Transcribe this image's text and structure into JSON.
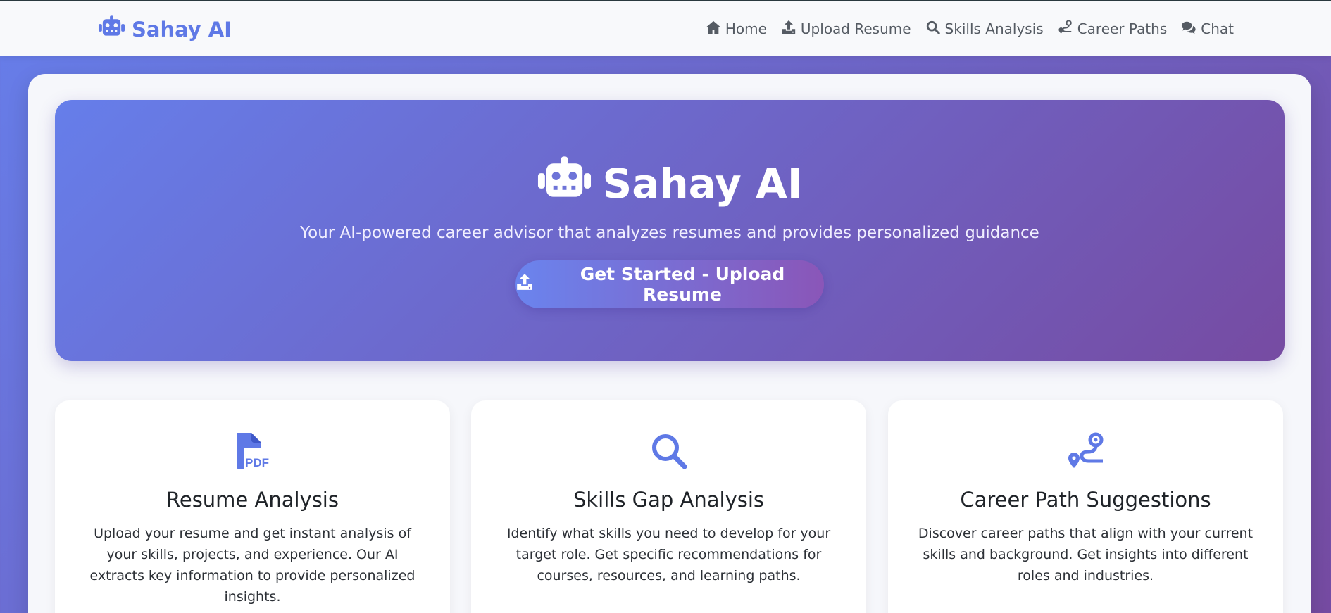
{
  "brand": {
    "name": "Sahay AI"
  },
  "nav": {
    "items": [
      {
        "label": "Home",
        "icon": "home-icon"
      },
      {
        "label": "Upload Resume",
        "icon": "upload-icon"
      },
      {
        "label": "Skills Analysis",
        "icon": "search-icon"
      },
      {
        "label": "Career Paths",
        "icon": "route-icon"
      },
      {
        "label": "Chat",
        "icon": "chat-icon"
      }
    ]
  },
  "hero": {
    "title": "Sahay AI",
    "subtitle": "Your AI-powered career advisor that analyzes resumes and provides personalized guidance",
    "cta_label": "Get Started - Upload Resume"
  },
  "features": [
    {
      "icon": "pdf-file-icon",
      "title": "Resume Analysis",
      "description": "Upload your resume and get instant analysis of your skills, projects, and experience. Our AI extracts key information to provide personalized insights."
    },
    {
      "icon": "search-icon",
      "title": "Skills Gap Analysis",
      "description": "Identify what skills you need to develop for your target role. Get specific recommendations for courses, resources, and learning paths."
    },
    {
      "icon": "route-icon",
      "title": "Career Path Suggestions",
      "description": "Discover career paths that align with your current skills and background. Get insights into different roles and industries."
    }
  ],
  "colors": {
    "accent": "#5f79e6",
    "gradient_start": "#667eea",
    "gradient_end": "#764ba2",
    "nav_text": "#555b63"
  }
}
